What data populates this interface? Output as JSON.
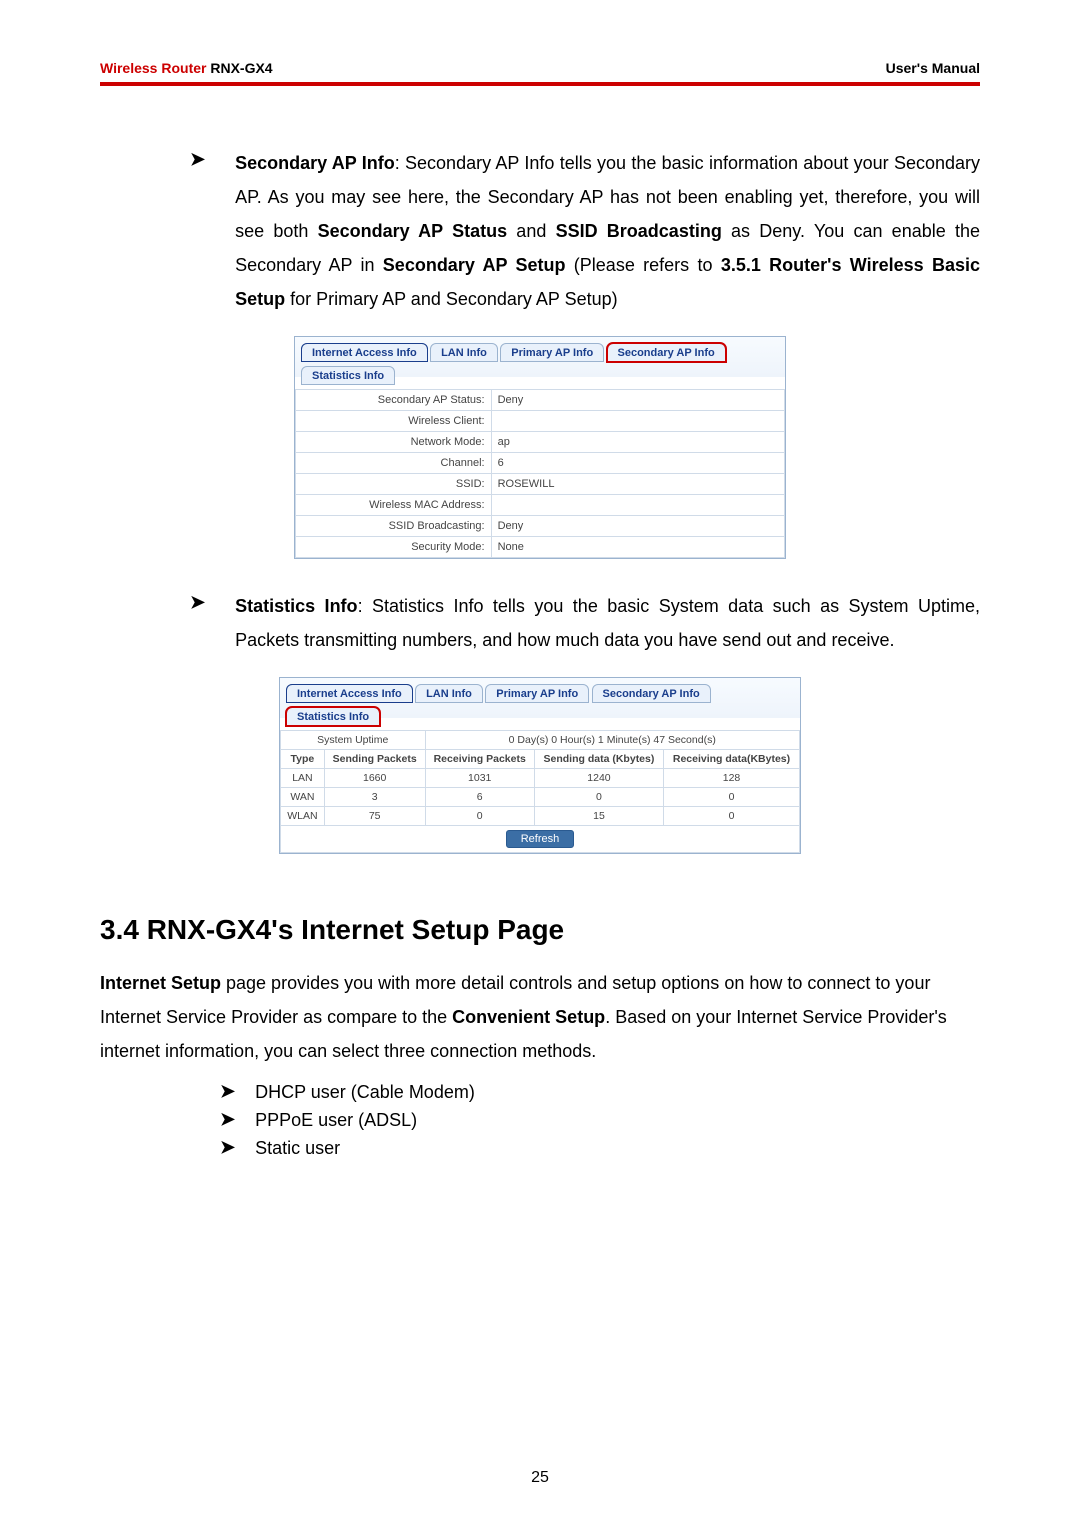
{
  "header": {
    "brand": "Wireless Router",
    "model": "RNX-GX4",
    "right": "User's Manual"
  },
  "block1": {
    "label_bold": "Secondary AP Info",
    "text_a": ": Secondary AP Info tells you the basic information about your Secondary AP. As you may see here, the Secondary AP has not been enabling yet, therefore, you will see both ",
    "b1": "Secondary AP Status",
    "text_b": " and ",
    "b2": "SSID Broadcasting",
    "text_c": " as Deny. You can enable the Secondary AP in ",
    "b3": "Secondary AP Setup",
    "text_d": " (Please refers to ",
    "b4": "3.5.1 Router's Wireless Basic Setup",
    "text_e": " for Primary AP and Secondary AP Setup)"
  },
  "fig1": {
    "tabs": [
      "Internet Access Info",
      "LAN Info",
      "Primary AP Info",
      "Secondary AP Info",
      "Statistics Info"
    ],
    "active_tab_index": 3,
    "rows": [
      {
        "k": "Secondary AP Status:",
        "v": "Deny"
      },
      {
        "k": "Wireless Client:",
        "v": ""
      },
      {
        "k": "Network Mode:",
        "v": "ap"
      },
      {
        "k": "Channel:",
        "v": "6"
      },
      {
        "k": "SSID:",
        "v": "ROSEWILL"
      },
      {
        "k": "Wireless MAC Address:",
        "v": ""
      },
      {
        "k": "SSID Broadcasting:",
        "v": "Deny"
      },
      {
        "k": "Security Mode:",
        "v": "None"
      }
    ]
  },
  "block2": {
    "label_bold": "Statistics Info",
    "text": ": Statistics Info tells you the basic System data such as System Uptime, Packets transmitting numbers, and how much data you have send out and receive."
  },
  "fig2": {
    "tabs": [
      "Internet Access Info",
      "LAN Info",
      "Primary AP Info",
      "Secondary AP Info",
      "Statistics Info"
    ],
    "active_tab_index": 4,
    "uptime_label": "System Uptime",
    "uptime_value": "0 Day(s) 0 Hour(s) 1 Minute(s) 47 Second(s)",
    "headers": [
      "Type",
      "Sending Packets",
      "Receiving Packets",
      "Sending data (Kbytes)",
      "Receiving data(KBytes)"
    ],
    "rows": [
      {
        "type": "LAN",
        "sp": "1660",
        "rp": "1031",
        "sd": "1240",
        "rd": "128"
      },
      {
        "type": "WAN",
        "sp": "3",
        "rp": "6",
        "sd": "0",
        "rd": "0"
      },
      {
        "type": "WLAN",
        "sp": "75",
        "rp": "0",
        "sd": "15",
        "rd": "0"
      }
    ],
    "refresh": "Refresh"
  },
  "section34": {
    "title": "3.4 RNX-GX4's Internet Setup Page",
    "p_b1": "Internet Setup",
    "p_t1": " page provides you with more detail controls and setup options on how to connect to your Internet Service Provider as compare to the ",
    "p_b2": "Convenient Setup",
    "p_t2": ". Based on your Internet Service Provider's internet information, you can select three connection methods.",
    "methods": [
      "DHCP user (Cable Modem)",
      "PPPoE user (ADSL)",
      "Static user"
    ]
  },
  "pagenum": "25"
}
